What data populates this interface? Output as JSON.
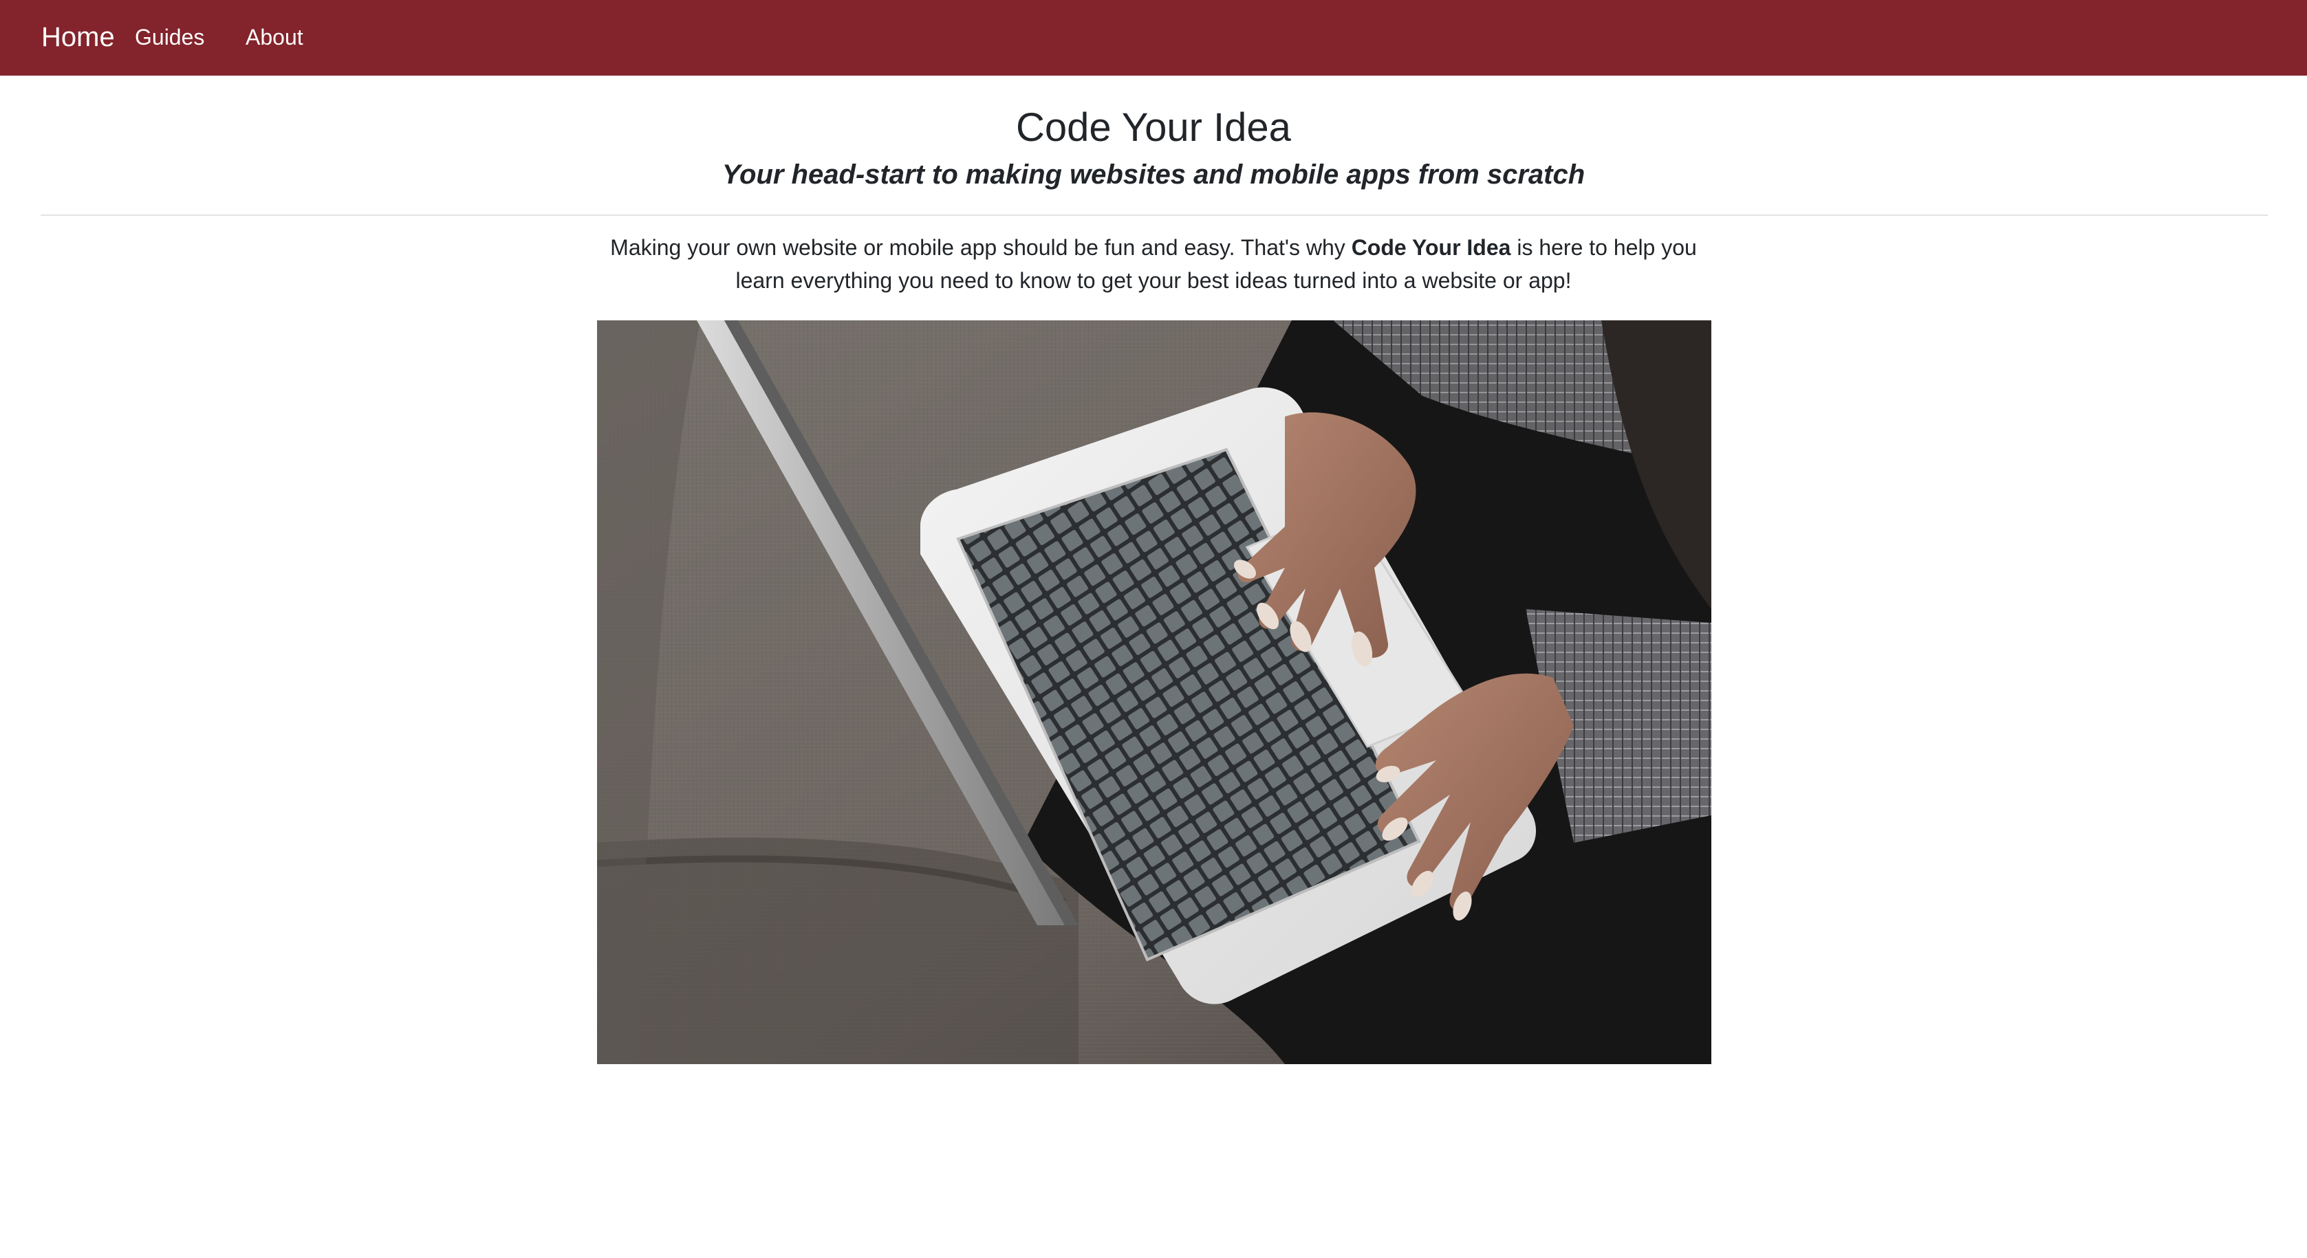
{
  "nav": {
    "brand": "Home",
    "links": [
      "Guides",
      "About"
    ]
  },
  "header": {
    "title": "Code Your Idea",
    "subtitle": "Your head-start to making websites and mobile apps from scratch"
  },
  "intro": {
    "before": "Making your own website or mobile app should be fun and easy. That's why ",
    "highlight": "Code Your Idea",
    "after": " is here to help you learn everything you need to know to get your best ideas turned into a website or app!"
  },
  "colors": {
    "navbar": "#83232b",
    "text": "#212529"
  },
  "hero": {
    "subject": "hands-typing-on-laptop-photo"
  }
}
